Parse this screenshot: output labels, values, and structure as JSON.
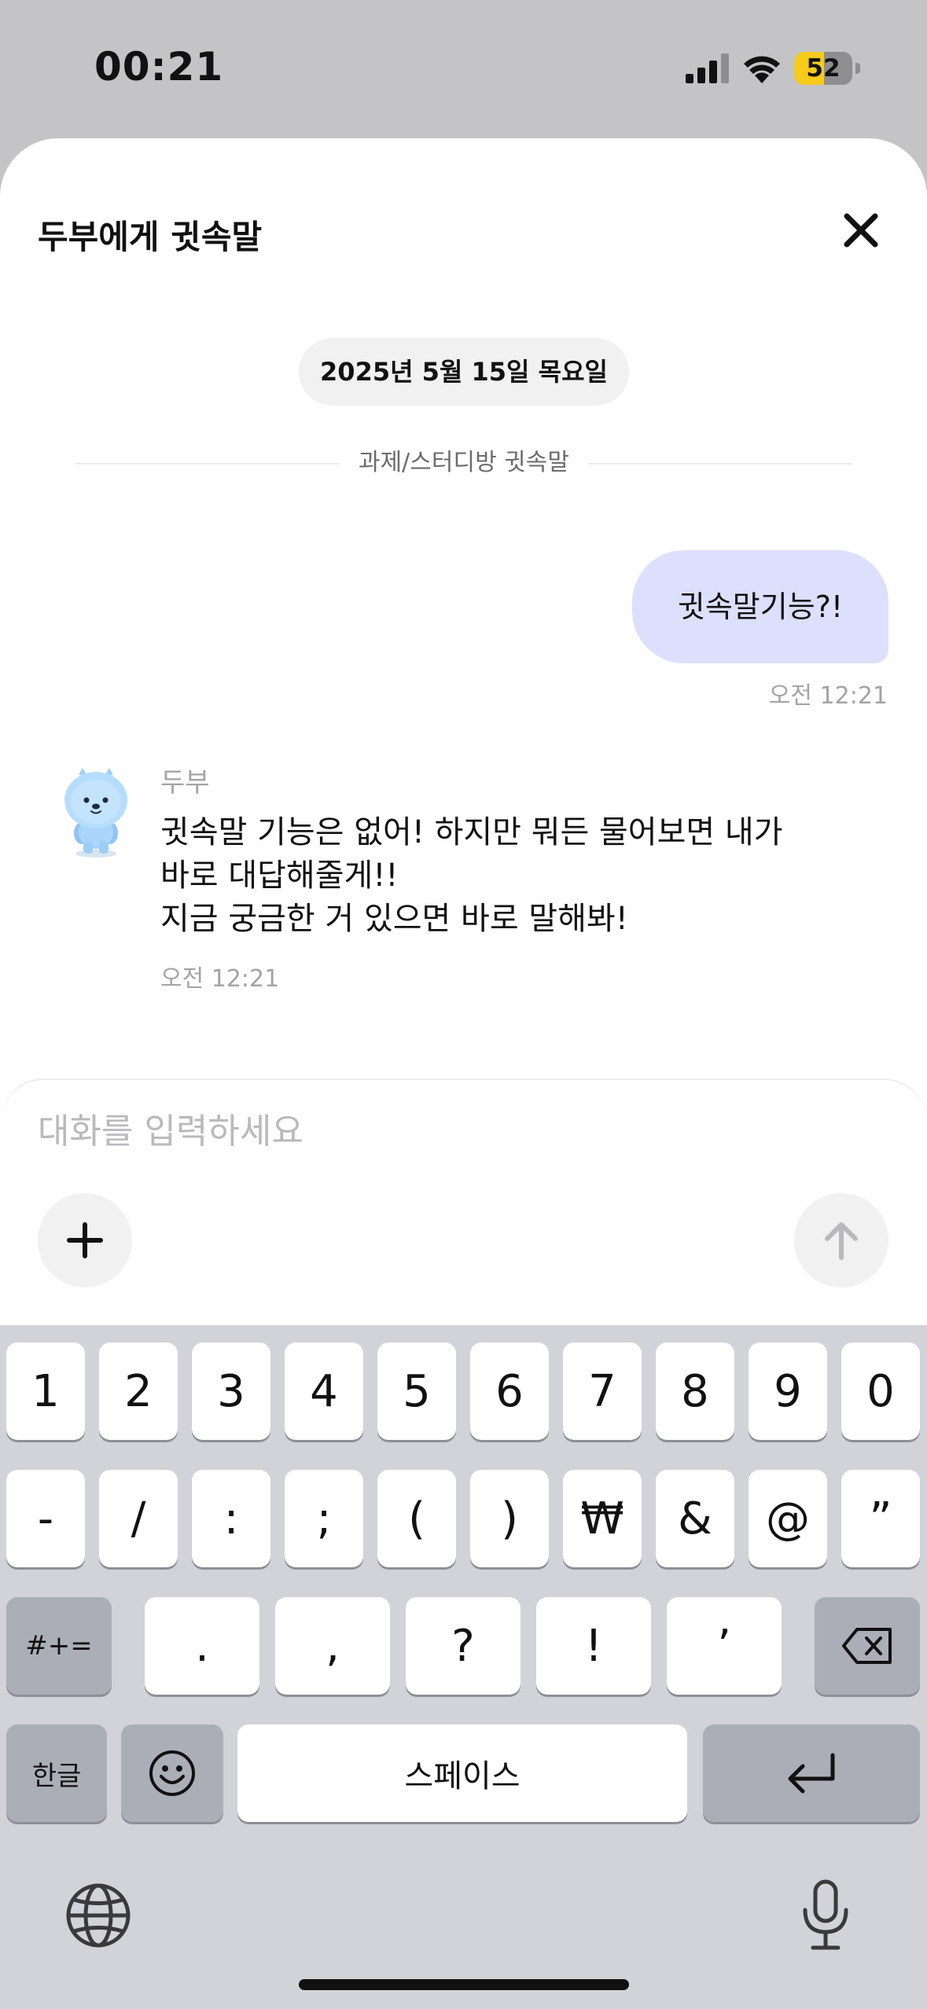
{
  "status_bar": {
    "time": "00:21",
    "battery_level": "52",
    "battery_fraction": 0.52
  },
  "sheet": {
    "title": "두부에게 귓속말",
    "close_icon": "close-icon"
  },
  "conversation": {
    "date_label": "2025년 5월 15일 목요일",
    "section_label": "과제/스터디방 귓속말",
    "user_message": {
      "text": "귓속말기능?!",
      "time": "오전 12:21"
    },
    "bot_message": {
      "sender": "두부",
      "lines": [
        "귓속말 기능은 없어! 하지만 뭐든 물어보면 내가",
        "바로 대답해줄게!!",
        "지금 궁금한 거 있으면 바로 말해봐!"
      ],
      "time": "오전 12:21"
    }
  },
  "composer": {
    "placeholder": "대화를 입력하세요",
    "plus_icon": "plus-icon",
    "send_icon": "arrow-up-icon"
  },
  "keyboard": {
    "row1": [
      "1",
      "2",
      "3",
      "4",
      "5",
      "6",
      "7",
      "8",
      "9",
      "0"
    ],
    "row2": [
      "-",
      "/",
      ":",
      ";",
      "(",
      ")",
      "₩",
      "&",
      "@",
      "”"
    ],
    "row3_left": "#+=",
    "row3": [
      ".",
      ",",
      "?",
      "!",
      "’"
    ],
    "row4_left": "한글",
    "space": "스페이스",
    "icons": {
      "backspace": "backspace-icon",
      "emoji": "emoji-icon",
      "return": "return-icon",
      "globe": "globe-icon",
      "microphone": "microphone-icon"
    }
  },
  "colors": {
    "status_bar_bg": "#c4c4c6",
    "user_bubble": "#dde0fd",
    "battery_fill": "#f6cb1b",
    "keyboard_bg": "#d2d3d9"
  }
}
